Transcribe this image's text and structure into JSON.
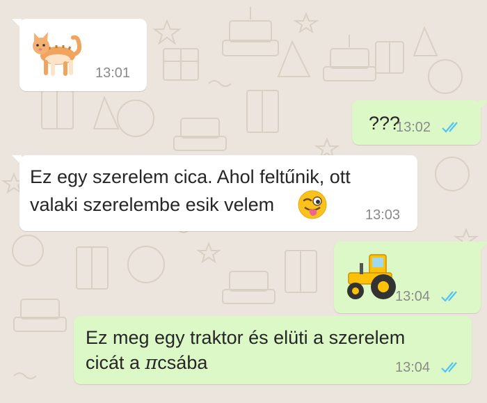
{
  "chat": {
    "messages": [
      {
        "direction": "incoming",
        "content": "cat-emoji",
        "time": "13:01"
      },
      {
        "direction": "outgoing",
        "text": "???",
        "time": "13:02",
        "status": "read"
      },
      {
        "direction": "incoming",
        "lines": [
          "Ez egy szerelem cica. Ahol feltűnik, ott",
          "valaki szerelembe esik velem"
        ],
        "emoji": "winking-tongue-face",
        "time": "13:03"
      },
      {
        "direction": "outgoing",
        "content": "tractor-emoji",
        "time": "13:04",
        "status": "read"
      },
      {
        "direction": "outgoing",
        "lines": [
          "Ez meg egy traktor és elüti a szerelem",
          "cicát a "
        ],
        "symbol": "π",
        "suffix": "csába",
        "time": "13:04",
        "status": "read"
      }
    ]
  },
  "colors": {
    "wallpaper": "#ece5dd",
    "incoming_bubble": "#ffffff",
    "outgoing_bubble": "#dcf8c6",
    "read_ticks": "#4fc3f7",
    "timestamp": "#8a8a8a"
  }
}
